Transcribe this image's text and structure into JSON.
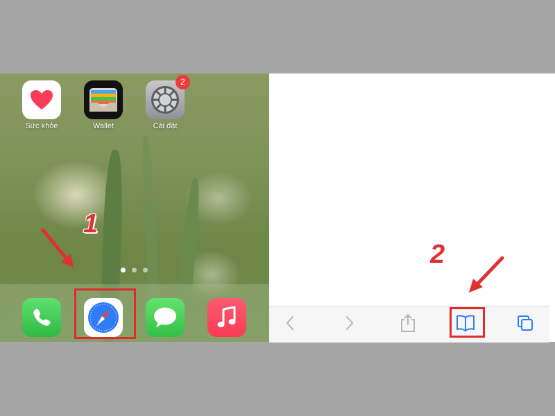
{
  "home_screen": {
    "apps": [
      {
        "label": "Sức khỏe",
        "icon": "health-heart-icon"
      },
      {
        "label": "Wallet",
        "icon": "wallet-icon"
      },
      {
        "label": "Cài đặt",
        "icon": "settings-gear-icon",
        "badge": "2"
      }
    ],
    "page_dots": {
      "count": 3,
      "active": 1
    },
    "dock": [
      {
        "icon": "phone-icon"
      },
      {
        "icon": "safari-compass-icon",
        "highlighted": true
      },
      {
        "icon": "messages-icon"
      },
      {
        "icon": "music-icon"
      }
    ]
  },
  "annotations": {
    "step1": "1",
    "step2": "2",
    "highlight_color": "#e02b2b"
  },
  "safari_toolbar": {
    "buttons": [
      {
        "icon": "back-chevron-icon"
      },
      {
        "icon": "forward-chevron-icon"
      },
      {
        "icon": "share-icon"
      },
      {
        "icon": "bookmarks-book-icon",
        "highlighted": true
      },
      {
        "icon": "tabs-icon"
      }
    ]
  },
  "colors": {
    "accent_blue": "#2f7cf6",
    "badge_red": "#f0393a",
    "annotation_red": "#e0302f"
  }
}
